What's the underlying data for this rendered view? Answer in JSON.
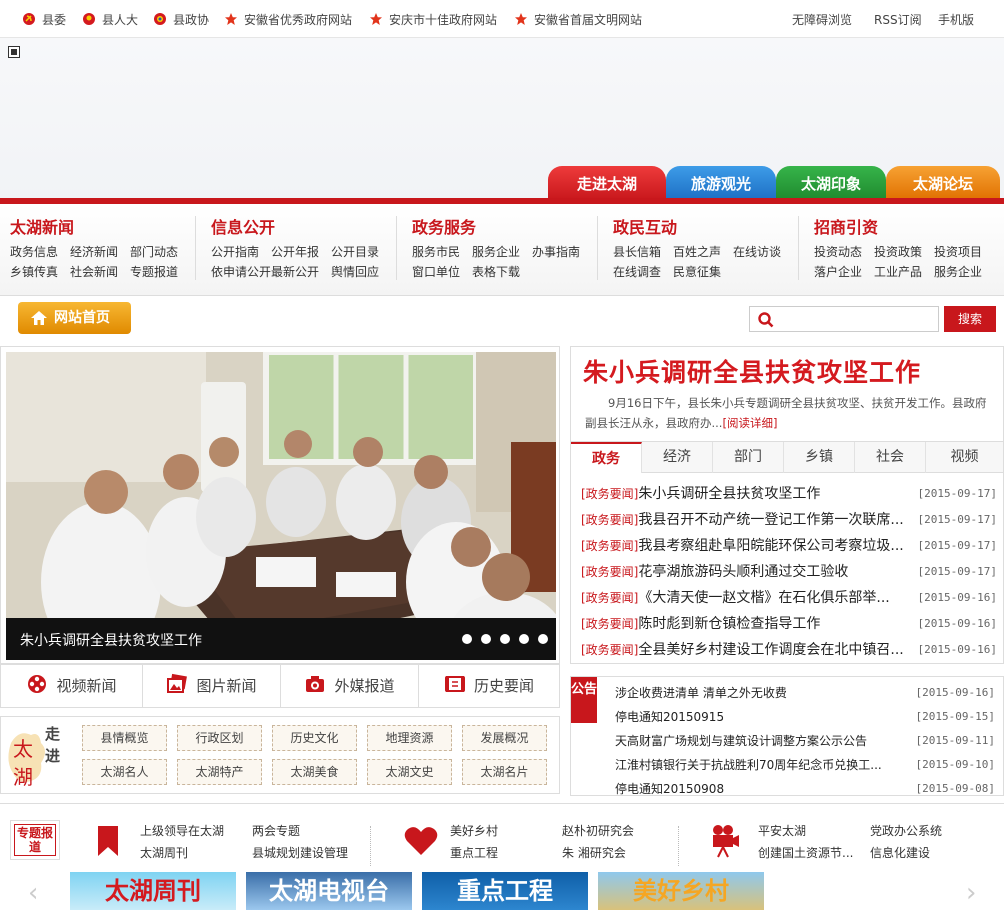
{
  "topbar": {
    "links": [
      "县委",
      "县人大",
      "县政协",
      "安徽省优秀政府网站",
      "安庆市十佳政府网站",
      "安徽省首届文明网站"
    ],
    "right": [
      "无障碍浏览",
      "RSS订阅",
      "手机版"
    ]
  },
  "banner_tabs": [
    "走进太湖",
    "旅游观光",
    "太湖印象",
    "太湖论坛"
  ],
  "nav": [
    {
      "title": "太湖新闻",
      "links": [
        "政务信息",
        "经济新闻",
        "部门动态",
        "乡镇传真",
        "社会新闻",
        "专题报道"
      ]
    },
    {
      "title": "信息公开",
      "links": [
        "公开指南",
        "公开年报",
        "公开目录",
        "依申请公开",
        "最新公开",
        "舆情回应"
      ]
    },
    {
      "title": "政务服务",
      "links": [
        "服务市民",
        "服务企业",
        "办事指南",
        "窗口单位",
        "表格下载"
      ]
    },
    {
      "title": "政民互动",
      "links": [
        "县长信箱",
        "百姓之声",
        "在线访谈",
        "在线调查",
        "民意征集"
      ]
    },
    {
      "title": "招商引资",
      "links": [
        "投资动态",
        "投资政策",
        "投资项目",
        "落户企业",
        "工业产品",
        "服务企业"
      ]
    }
  ],
  "home_label": "网站首页",
  "search": {
    "placeholder": "",
    "button": "搜索"
  },
  "photo_caption": "朱小兵调研全县扶贫攻坚工作",
  "headline": {
    "title": "朱小兵调研全县扶贫攻坚工作",
    "summary": "9月16日下午，县长朱小兵专题调研全县扶贫攻坚、扶贫开发工作。县政府副县长汪从永，县政府办...",
    "more": "[阅读详细]"
  },
  "news_tabs": [
    "政务",
    "经济",
    "部门",
    "乡镇",
    "社会",
    "视频"
  ],
  "news": [
    {
      "tag": "[政务要闻]",
      "title": "朱小兵调研全县扶贫攻坚工作",
      "date": "[2015-09-17]"
    },
    {
      "tag": "[政务要闻]",
      "title": "我县召开不动产统一登记工作第一次联席...",
      "date": "[2015-09-17]"
    },
    {
      "tag": "[政务要闻]",
      "title": "我县考察组赴阜阳皖能环保公司考察垃圾...",
      "date": "[2015-09-17]"
    },
    {
      "tag": "[政务要闻]",
      "title": "花亭湖旅游码头顺利通过交工验收",
      "date": "[2015-09-17]"
    },
    {
      "tag": "[政务要闻]",
      "title": "《大清天使一赵文楷》在石化俱乐部举...",
      "date": "[2015-09-16]"
    },
    {
      "tag": "[政务要闻]",
      "title": "陈时彪到新仓镇检查指导工作",
      "date": "[2015-09-16]"
    },
    {
      "tag": "[政务要闻]",
      "title": "全县美好乡村建设工作调度会在北中镇召...",
      "date": "[2015-09-16]"
    }
  ],
  "media_buttons": [
    "视频新闻",
    "图片新闻",
    "外媒报道",
    "历史要闻"
  ],
  "notice": {
    "label": "公告",
    "items": [
      {
        "title": "涉企收费进清单 清单之外无收费",
        "date": "[2015-09-16]"
      },
      {
        "title": "停电通知20150915",
        "date": "[2015-09-15]"
      },
      {
        "title": "天高财富广场规划与建筑设计调整方案公示公告",
        "date": "[2015-09-11]"
      },
      {
        "title": "江淮村镇银行关于抗战胜利70周年纪念币兑换工...",
        "date": "[2015-09-10]"
      },
      {
        "title": "停电通知20150908",
        "date": "[2015-09-08]"
      }
    ]
  },
  "intro": {
    "logo_walk": "走进",
    "logo_name": "太湖",
    "items": [
      "县情概览",
      "行政区划",
      "历史文化",
      "地理资源",
      "发展概况",
      "太湖名人",
      "太湖特产",
      "太湖美食",
      "太湖文史",
      "太湖名片"
    ]
  },
  "special": {
    "label": "专题报道",
    "links": [
      "上级领导在太湖",
      "两会专题",
      "太湖周刊",
      "县城规划建设管理",
      "美好乡村",
      "赵朴初研究会",
      "重点工程",
      "朱 湘研究会",
      "平安太湖",
      "党政办公系统",
      "创建国土资源节...",
      "信息化建设"
    ]
  },
  "banners": [
    "太湖周刊",
    "太湖电视台",
    "重点工程",
    "美好乡村"
  ],
  "arrows": {
    "left": "‹",
    "right": "›"
  },
  "colors": {
    "brand_red": "#c8171c",
    "orange": "#e08a00"
  }
}
